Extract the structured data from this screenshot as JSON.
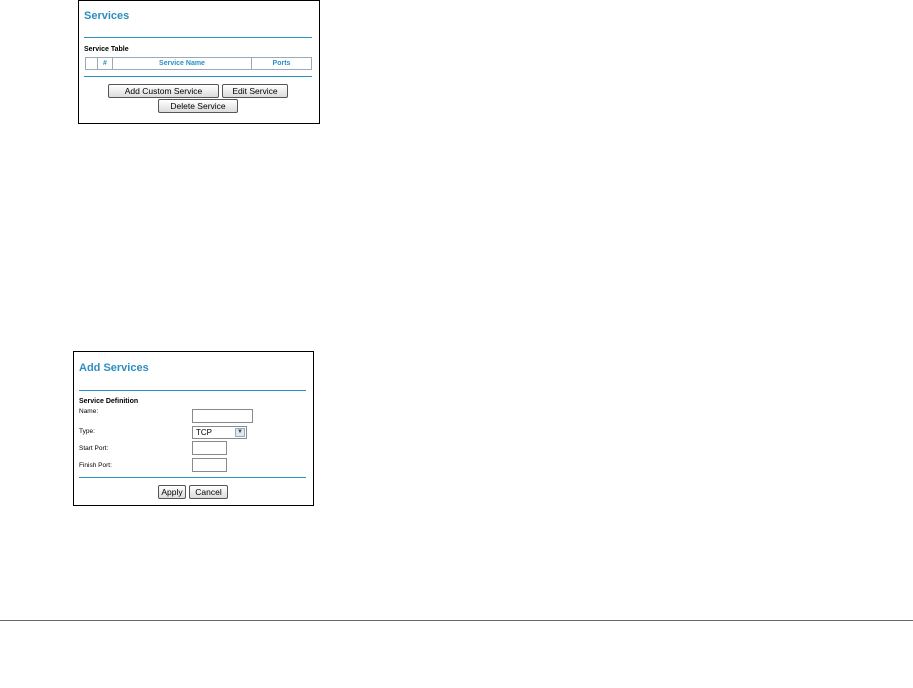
{
  "services_panel": {
    "title": "Services",
    "table_label": "Service Table",
    "columns": [
      "",
      "#",
      "Service Name",
      "Ports"
    ],
    "buttons": {
      "add_custom": "Add Custom Service",
      "edit": "Edit Service",
      "delete": "Delete Service"
    }
  },
  "add_services_panel": {
    "title": "Add Services",
    "section_label": "Service Definition",
    "fields": {
      "name_label": "Name:",
      "type_label": "Type:",
      "type_value": "TCP",
      "start_port_label": "Start Port:",
      "finish_port_label": "Finish Port:"
    },
    "buttons": {
      "apply": "Apply",
      "cancel": "Cancel"
    }
  },
  "colors": {
    "accent": "#2b8fc1",
    "border": "#000000"
  },
  "icons": {
    "dropdown": "chevron-down-icon"
  }
}
